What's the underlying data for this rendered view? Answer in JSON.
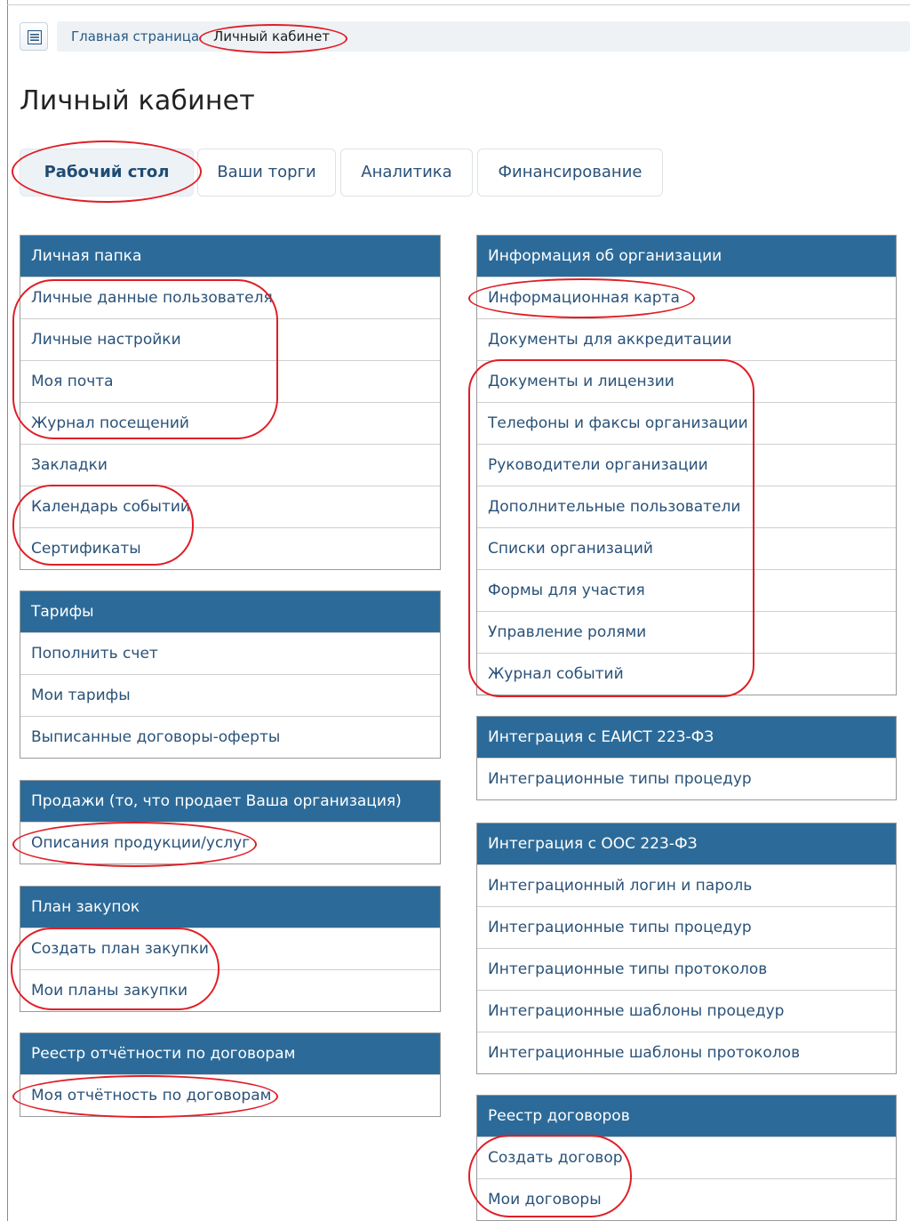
{
  "breadcrumb": {
    "home": "Главная страница",
    "current": "Личный кабинет"
  },
  "page_title": "Личный кабинет",
  "tabs": [
    {
      "label": "Рабочий стол",
      "active": true
    },
    {
      "label": "Ваши торги"
    },
    {
      "label": "Аналитика"
    },
    {
      "label": "Финансирование"
    }
  ],
  "left_panels": [
    {
      "title": "Личная папка",
      "items": [
        "Личные данные пользователя",
        "Личные настройки",
        "Моя почта",
        "Журнал посещений",
        "Закладки",
        "Календарь событий",
        "Сертификаты"
      ]
    },
    {
      "title": "Тарифы",
      "items": [
        "Пополнить счет",
        "Мои тарифы",
        "Выписанные договоры-оферты"
      ]
    },
    {
      "title": "Продажи (то, что продает Ваша организация)",
      "items": [
        "Описания продукции/услуг"
      ]
    },
    {
      "title": "План закупок",
      "items": [
        "Создать план закупки",
        "Мои планы закупки"
      ]
    },
    {
      "title": "Реестр отчётности по договорам",
      "items": [
        "Моя отчётность по договорам"
      ]
    }
  ],
  "right_panels": [
    {
      "title": "Информация об организации",
      "items": [
        "Информационная карта",
        "Документы для аккредитации",
        "Документы и лицензии",
        "Телефоны и факсы организации",
        "Руководители организации",
        "Дополнительные пользователи",
        "Списки организаций",
        "Формы для участия",
        "Управление ролями",
        "Журнал событий"
      ]
    },
    {
      "title": "Интеграция с ЕАИСТ 223-ФЗ",
      "items": [
        "Интеграционные типы процедур"
      ]
    },
    {
      "title": "Интеграция с ООС 223-ФЗ",
      "items": [
        "Интеграционный логин и пароль",
        "Интеграционные типы процедур",
        "Интеграционные типы протоколов",
        "Интеграционные шаблоны процедур",
        "Интеграционные шаблоны протоколов"
      ]
    },
    {
      "title": "Реестр договоров",
      "items": [
        "Создать договор",
        "Мои договоры"
      ]
    }
  ],
  "colors": {
    "header_bg": "#2c6b99",
    "link": "#2a5278",
    "highlight": "#e01e26"
  },
  "icons": {
    "menu": "list-menu-icon"
  }
}
